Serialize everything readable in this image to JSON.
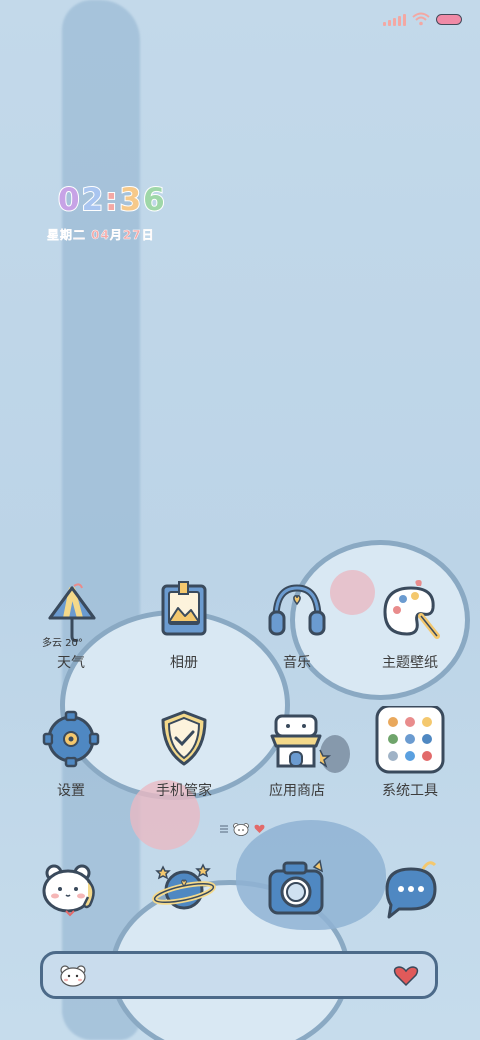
{
  "status_bar": {
    "signal_icon": "signal-bars-icon",
    "wifi_icon": "wifi-icon",
    "battery_icon": "battery-icon",
    "accent": "#f3a8a3"
  },
  "clock": {
    "digits": [
      {
        "ch": "0",
        "color": "#c7a3e6"
      },
      {
        "ch": "2",
        "color": "#a9c5f0"
      },
      {
        "ch": ":",
        "color": "#f4a8a4"
      },
      {
        "ch": "3",
        "color": "#f6c98a"
      },
      {
        "ch": "6",
        "color": "#9fd7a8"
      }
    ],
    "date": "星期二  04月27日"
  },
  "home": {
    "rows": [
      [
        {
          "id": "weather",
          "label": "天气",
          "icon": "umbrella-icon",
          "widget_text": "多云 20°"
        },
        {
          "id": "gallery",
          "label": "相册",
          "icon": "photo-icon"
        },
        {
          "id": "music",
          "label": "音乐",
          "icon": "headphones-icon"
        },
        {
          "id": "themes",
          "label": "主题壁纸",
          "icon": "palette-icon"
        }
      ],
      [
        {
          "id": "settings",
          "label": "设置",
          "icon": "gear-icon"
        },
        {
          "id": "security",
          "label": "手机管家",
          "icon": "shield-icon"
        },
        {
          "id": "appstore",
          "label": "应用商店",
          "icon": "shop-icon"
        },
        {
          "id": "tools",
          "label": "系统工具",
          "icon": "folder-icon"
        }
      ]
    ],
    "dock": [
      {
        "id": "phone",
        "icon": "phone-bear-icon"
      },
      {
        "id": "browser",
        "icon": "planet-icon"
      },
      {
        "id": "camera",
        "icon": "camera-icon"
      },
      {
        "id": "messages",
        "icon": "chat-bubble-icon"
      }
    ],
    "page_indicator": {
      "icons": [
        "menu-icon",
        "bear-icon",
        "heart-icon"
      ]
    },
    "search_bar": {
      "left_icon": "bear-face-icon",
      "right_icon": "heart-icon"
    }
  }
}
